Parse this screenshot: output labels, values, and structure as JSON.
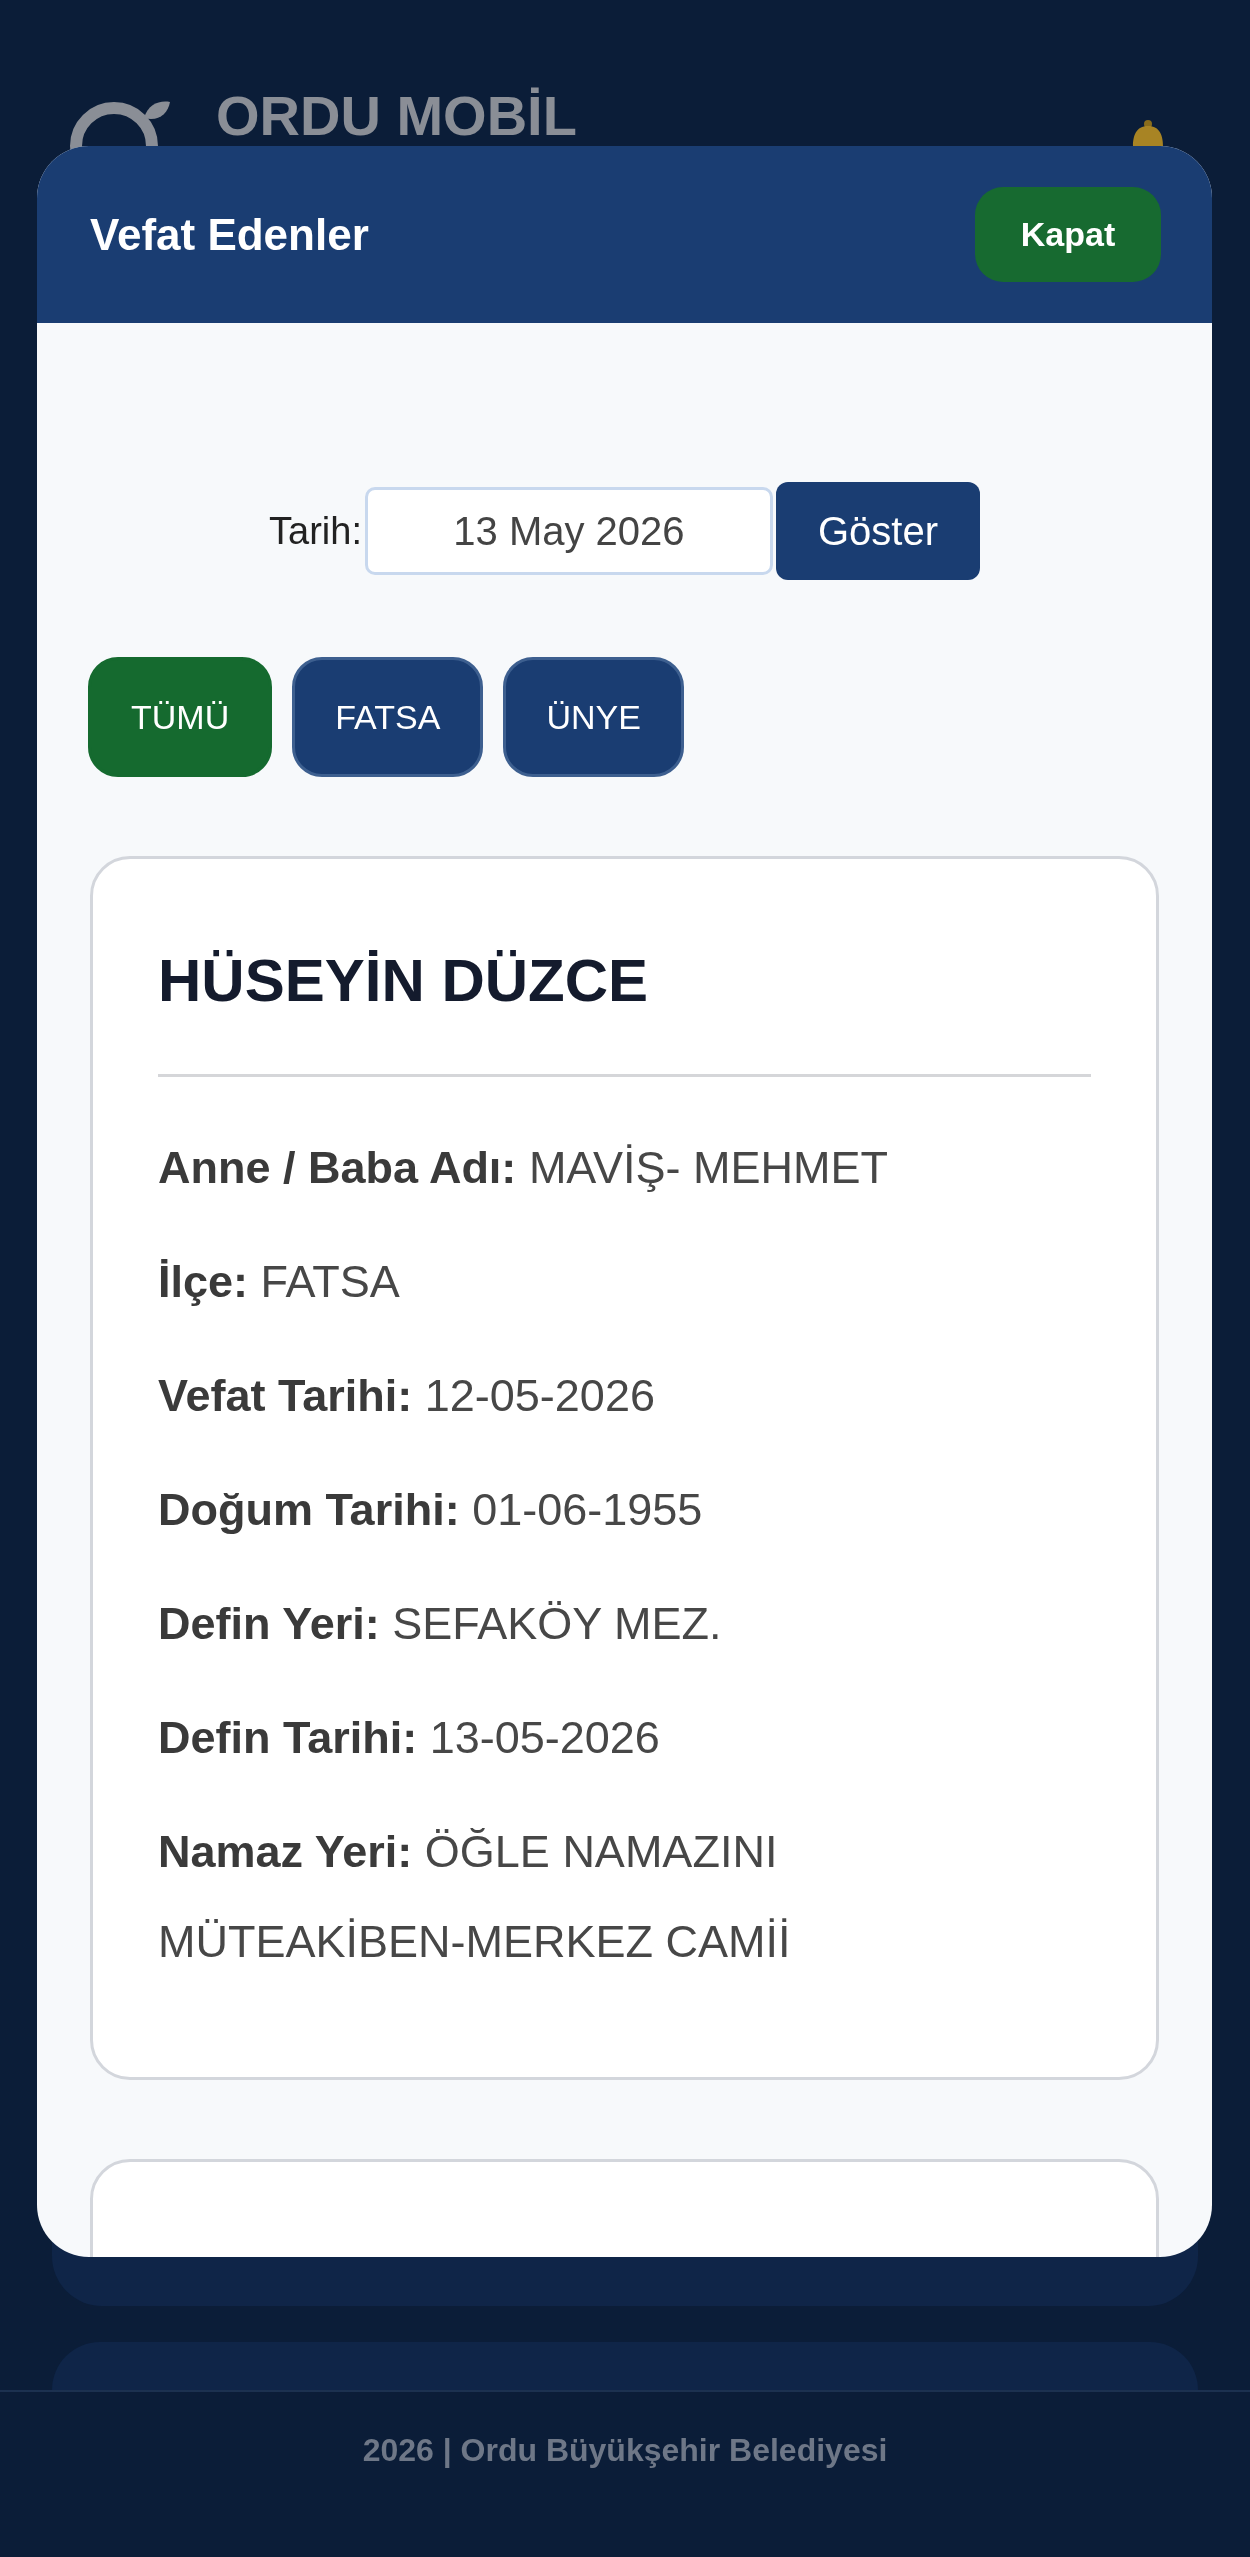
{
  "app_header": {
    "title": "ORDU MOBİL"
  },
  "modal": {
    "title": "Vefat Edenler",
    "close_button": "Kapat",
    "date_filter": {
      "label": "Tarih:",
      "value": "13 May 2026",
      "button": "Göster"
    },
    "district_filters": [
      {
        "label": "TÜMÜ",
        "selected": true
      },
      {
        "label": "FATSA",
        "selected": false
      },
      {
        "label": "ÜNYE",
        "selected": false
      }
    ],
    "records": [
      {
        "name": "HÜSEYİN DÜZCE",
        "fields": [
          {
            "label": "Anne / Baba Adı:",
            "value": "MAVİŞ- MEHMET"
          },
          {
            "label": "İlçe:",
            "value": "FATSA"
          },
          {
            "label": "Vefat Tarihi:",
            "value": "12-05-2026"
          },
          {
            "label": "Doğum Tarihi:",
            "value": "01-06-1955"
          },
          {
            "label": "Defin Yeri:",
            "value": "SEFAKÖY MEZ."
          },
          {
            "label": "Defin Tarihi:",
            "value": "13-05-2026"
          },
          {
            "label": "Namaz Yeri:",
            "value": "ÖĞLE NAMAZINI MÜTEAKİBEN-MERKEZ CAMİİ"
          }
        ]
      }
    ],
    "more_records_below": true
  },
  "footer": {
    "text": "2026 | Ordu Büyükşehir Belediyesi"
  }
}
